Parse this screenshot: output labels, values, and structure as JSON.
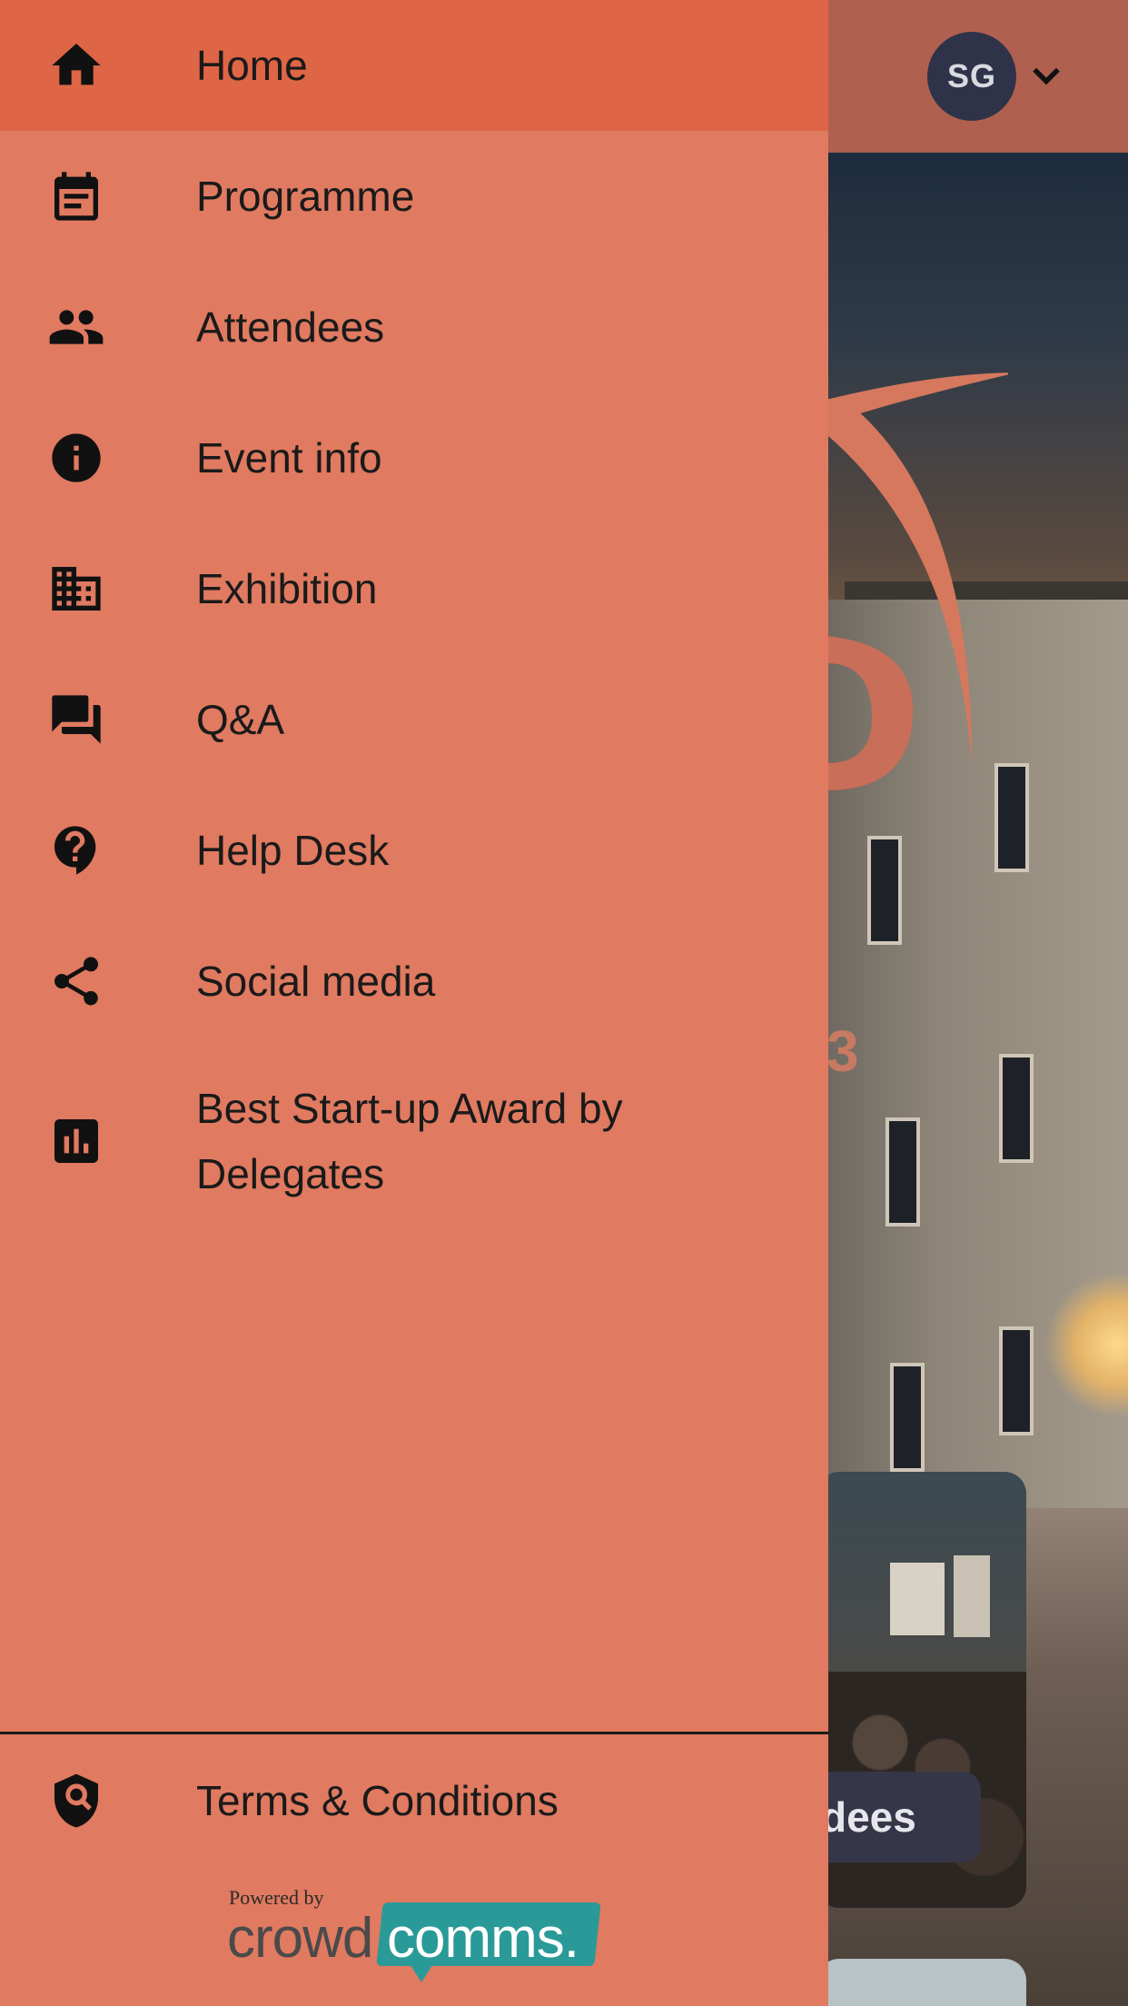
{
  "header": {
    "avatar_initials": "SG"
  },
  "background": {
    "year_fragment": "3",
    "card_button_label": "dees"
  },
  "drawer": {
    "items": [
      {
        "label": "Home",
        "icon": "home-icon",
        "active": true
      },
      {
        "label": "Programme",
        "icon": "calendar-icon",
        "active": false
      },
      {
        "label": "Attendees",
        "icon": "people-icon",
        "active": false
      },
      {
        "label": "Event info",
        "icon": "info-icon",
        "active": false
      },
      {
        "label": "Exhibition",
        "icon": "building-icon",
        "active": false
      },
      {
        "label": "Q&A",
        "icon": "forum-icon",
        "active": false
      },
      {
        "label": "Help Desk",
        "icon": "help-icon",
        "active": false
      },
      {
        "label": "Social media",
        "icon": "share-icon",
        "active": false
      },
      {
        "label": "Best Start-up Award by Delegates",
        "icon": "poll-icon",
        "active": false
      }
    ],
    "footer_item": {
      "label": "Terms & Conditions",
      "icon": "shield-search-icon"
    },
    "powered_by": {
      "prefix": "Powered by",
      "brand_left": "crowd",
      "brand_right": "comms."
    }
  },
  "colors": {
    "drawer_bg": "#e07a60",
    "active_item_bg": "#de6545",
    "header_bg": "#b0604f",
    "avatar_bg": "#2f3349",
    "brand_teal": "#2a9a98"
  }
}
